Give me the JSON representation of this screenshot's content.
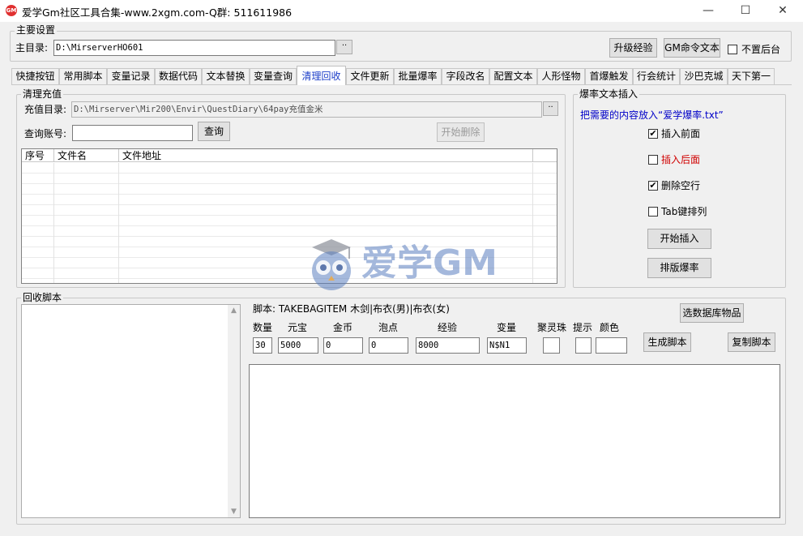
{
  "window": {
    "title": "爱学Gm社区工具合集-www.2xgm.com-Q群: 511611986",
    "app_icon_text": "GM",
    "controls": {
      "minimize": "—",
      "maximize": "☐",
      "close": "✕"
    }
  },
  "main_settings": {
    "group_label": "主要设置",
    "dir_label": "主目录:",
    "dir_value": "D:\\MirserverHO601",
    "browse_label": "··",
    "upgrade_button": "升级经验",
    "gm_button": "GM命令文本",
    "not_top_label": "不置后台",
    "not_top_checked": false
  },
  "tabs": [
    "快捷按钮",
    "常用脚本",
    "变量记录",
    "数据代码",
    "文本替换",
    "变量查询",
    "清理回收",
    "文件更新",
    "批量爆率",
    "字段改名",
    "配置文本",
    "人形怪物",
    "首爆触发",
    "行会统计",
    "沙巴克城",
    "天下第一"
  ],
  "active_tab": 6,
  "recharge": {
    "group_label": "清理充值",
    "dir_label": "充值目录:",
    "dir_value": "D:\\Mirserver\\Mir200\\Envir\\QuestDiary\\64pay充值金米",
    "browse_label": "··",
    "account_label": "查询账号:",
    "account_value": "",
    "query_button": "查询",
    "delete_button": "开始删除",
    "columns": [
      "序号",
      "文件名",
      "文件地址"
    ],
    "rows": []
  },
  "droprate": {
    "group_label": "爆率文本插入",
    "hint": "把需要的内容放入“爱学爆率.txt”",
    "options": [
      {
        "label": "插入前面",
        "checked": true,
        "color": "#000000"
      },
      {
        "label": "插入后面",
        "checked": false,
        "color": "#d00000"
      },
      {
        "label": "删除空行",
        "checked": true,
        "color": "#000000"
      },
      {
        "label": "Tab键排列",
        "checked": false,
        "color": "#000000"
      }
    ],
    "start_button": "开始插入",
    "layout_button": "排版爆率"
  },
  "recycle": {
    "group_label": "回收脚本",
    "script_text": "脚本: TAKEBAGITEM 木剑|布衣(男)|布衣(女)",
    "select_button": "选数据库物品",
    "fields": [
      {
        "label": "数量",
        "value": "30"
      },
      {
        "label": "元宝",
        "value": "5000"
      },
      {
        "label": "金币",
        "value": "0"
      },
      {
        "label": "泡点",
        "value": "0"
      },
      {
        "label": "经验",
        "value": "8000"
      },
      {
        "label": "变量",
        "value": "N$N1"
      },
      {
        "label": "聚灵珠",
        "value": ""
      },
      {
        "label": "提示",
        "value": ""
      },
      {
        "label": "颜色",
        "value": ""
      }
    ],
    "generate_button": "生成脚本",
    "copy_button": "复制脚本",
    "output_text": ""
  },
  "watermark": {
    "text": "爱学GM"
  },
  "colors": {
    "active_tab_text": "#1a3cc8",
    "hint_text": "#0000c8",
    "watermark": "#5b7fc0"
  }
}
